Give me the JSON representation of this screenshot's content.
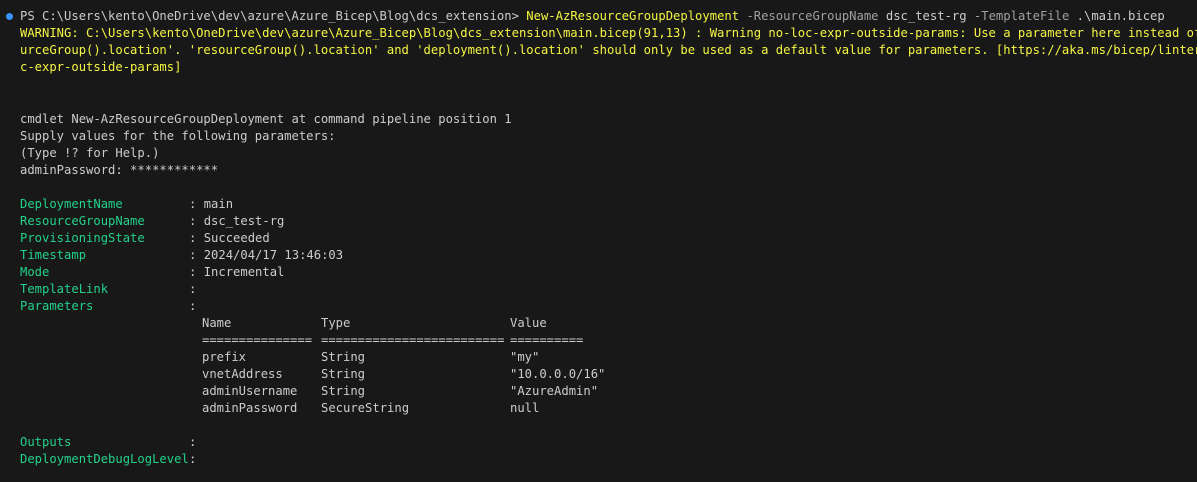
{
  "prompt": {
    "prefix": "PS C:\\Users\\kento\\OneDrive\\dev\\azure\\Azure_Bicep\\Blog\\dcs_extension>",
    "command": "New-AzResourceGroupDeployment",
    "param1": "-ResourceGroupName",
    "arg1": "dsc_test-rg",
    "param2": "-TemplateFile",
    "arg2": ".\\main.bicep"
  },
  "warning": {
    "line1": "WARNING: C:\\Users\\kento\\OneDrive\\dev\\azure\\Azure_Bicep\\Blog\\dcs_extension\\main.bicep(91,13) : Warning no-loc-expr-outside-params: Use a parameter here instead of 'reso",
    "line2": "urceGroup().location'. 'resourceGroup().location' and 'deployment().location' should only be used as a default value for parameters. [https://aka.ms/bicep/linter/no-lo",
    "line3": "c-expr-outside-params]"
  },
  "cmdlet": {
    "line1": "cmdlet New-AzResourceGroupDeployment at command pipeline position 1",
    "line2": "Supply values for the following parameters:",
    "line3": "(Type !? for Help.)",
    "line4": "adminPassword: ************"
  },
  "result": [
    {
      "key": "DeploymentName",
      "value": "main"
    },
    {
      "key": "ResourceGroupName",
      "value": "dsc_test-rg"
    },
    {
      "key": "ProvisioningState",
      "value": "Succeeded"
    },
    {
      "key": "Timestamp",
      "value": "2024/04/17 13:46:03"
    },
    {
      "key": "Mode",
      "value": "Incremental"
    },
    {
      "key": "TemplateLink",
      "value": ""
    },
    {
      "key": "Parameters",
      "value": ""
    }
  ],
  "params_table": {
    "headers": [
      "Name",
      "Type",
      "Value"
    ],
    "rules": [
      "===============",
      "=========================",
      "=========="
    ],
    "rows": [
      [
        "prefix",
        "String",
        "\"my\""
      ],
      [
        "vnetAddress",
        "String",
        "\"10.0.0.0/16\""
      ],
      [
        "adminUsername",
        "String",
        "\"AzureAdmin\""
      ],
      [
        "adminPassword",
        "SecureString",
        "null"
      ]
    ]
  },
  "tail": [
    {
      "key": "Outputs",
      "value": ""
    },
    {
      "key": "DeploymentDebugLogLevel",
      "value": ""
    }
  ],
  "separator": ": ",
  "colors": {
    "background": "#181818",
    "text": "#cccccc",
    "warning": "#f5f543",
    "property_key": "#23d18b",
    "parameter_flag": "#a0a0a0",
    "prompt_dot": "#3794ff"
  }
}
